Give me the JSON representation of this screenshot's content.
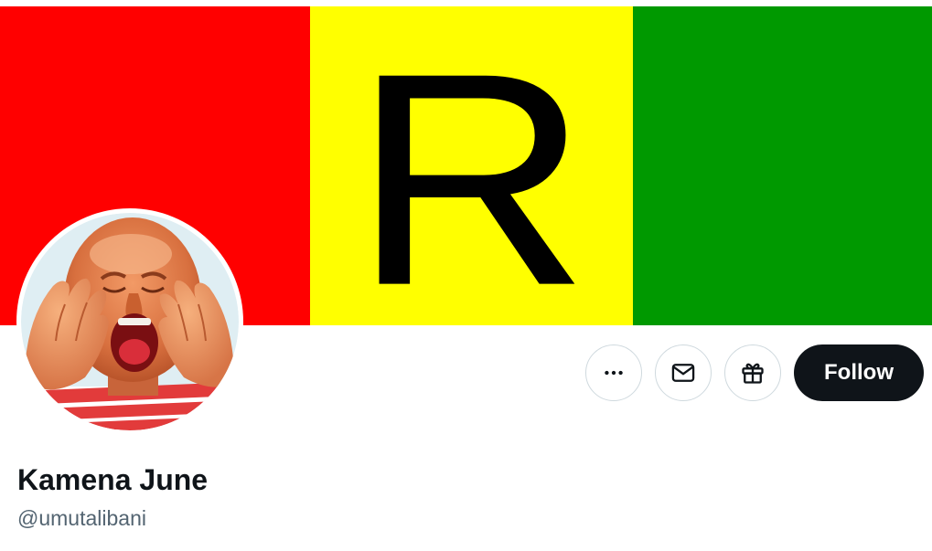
{
  "banner": {
    "letter": "R",
    "colors": {
      "left": "#ff0000",
      "middle": "#ffff00",
      "right": "#009900",
      "letter": "#000000"
    }
  },
  "profile": {
    "display_name": "Kamena June",
    "handle": "@umutalibani",
    "avatar": "child-shouting-photo"
  },
  "actions": {
    "more_icon": "more-horizontal-icon",
    "message_icon": "envelope-icon",
    "gift_icon": "gift-icon",
    "follow_label": "Follow"
  },
  "colors": {
    "text_primary": "#0f1419",
    "text_secondary": "#536471",
    "button_border": "#cfd9de",
    "follow_bg": "#0f1419",
    "follow_text": "#ffffff"
  }
}
